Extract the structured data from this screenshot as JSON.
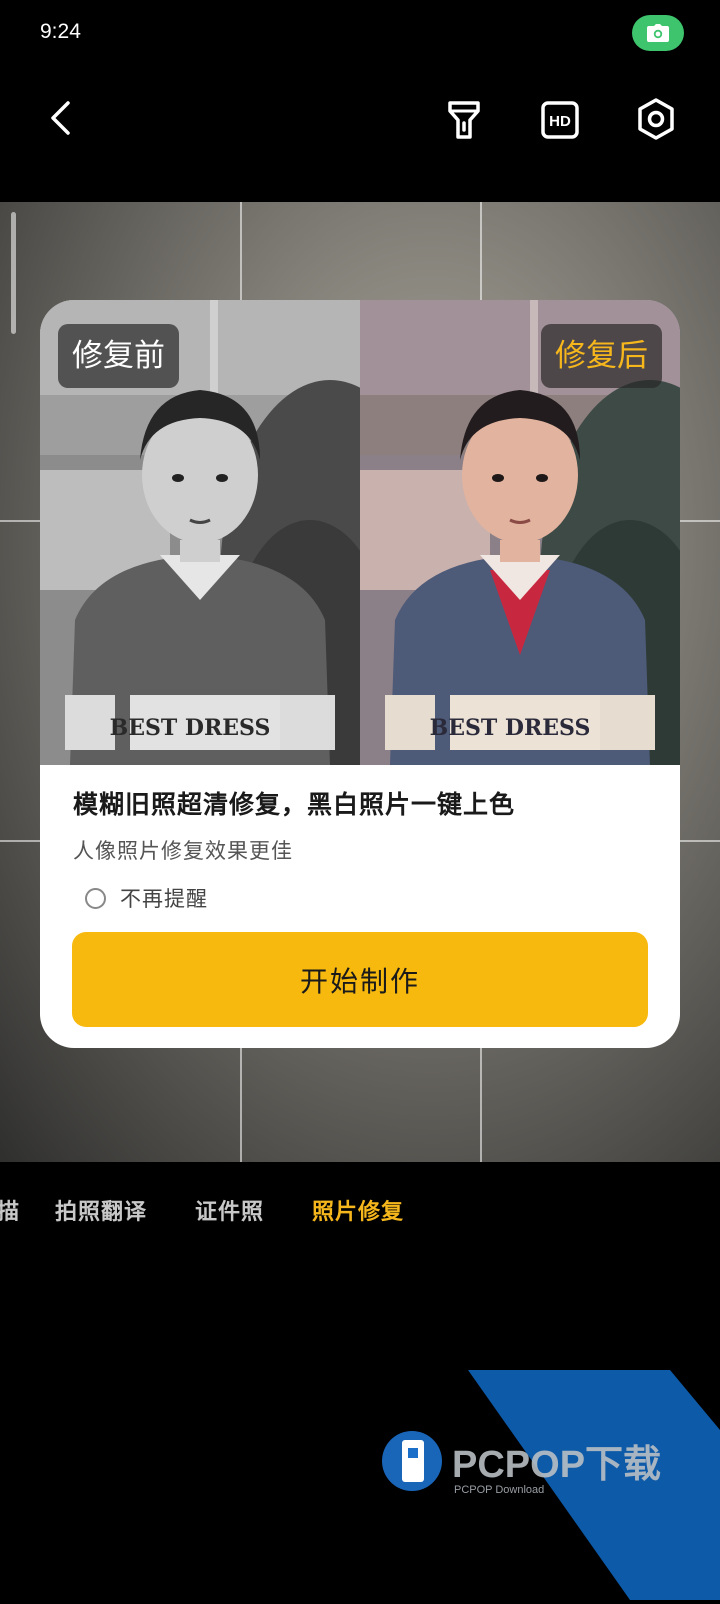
{
  "status_bar": {
    "time": "9:24",
    "icon": "camera-icon"
  },
  "toolbar": {
    "back_icon": "chevron-left-icon",
    "flashlight_icon": "flashlight-icon",
    "hd_label": "HD",
    "settings_icon": "settings-icon"
  },
  "dialog": {
    "before_label": "修复前",
    "after_label": "修复后",
    "title": "模糊旧照超清修复，黑白照片一键上色",
    "subtitle": "人像照片修复效果更佳",
    "dont_remind": "不再提醒",
    "dont_remind_checked": false,
    "start_button": "开始制作",
    "photo_text": "BEST DRESS"
  },
  "modes": {
    "items": [
      "描",
      "拍照翻译",
      "证件照",
      "照片修复"
    ],
    "active_index": 3
  },
  "watermark": {
    "brand": "PCPOP下载",
    "sub": "PCPOP Download"
  },
  "colors": {
    "accent": "#f7b90e",
    "active_mode": "#f6b71c",
    "pill_green": "#3ec46d",
    "watermark_blue": "#0d5aa8"
  }
}
